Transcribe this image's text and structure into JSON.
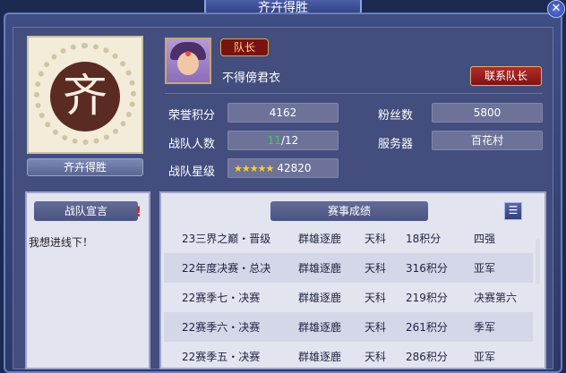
{
  "window": {
    "title": "齐卉得胜",
    "close_icon": "close-icon"
  },
  "team": {
    "emblem_char": "齐",
    "name": "齐卉得胜"
  },
  "captain": {
    "badge": "队长",
    "name": "不得傍君衣",
    "contact_button": "联系队长"
  },
  "stats": {
    "honor_label": "荣誉积分",
    "honor_value": "4162",
    "fans_label": "粉丝数",
    "fans_value": "5800",
    "members_label": "战队人数",
    "members_current": "11",
    "members_total": "/12",
    "server_label": "服务器",
    "server_value": "百花村",
    "rank_label": "战队星级",
    "rank_stars": "★★★★★",
    "rank_value": "42820"
  },
  "manifesto": {
    "title": "战队宣言",
    "alert": "!",
    "text": "我想进线下！"
  },
  "results": {
    "title": "赛事成绩",
    "rows": [
      {
        "event": "23三界之巅・晋级",
        "group": "群雄逐鹿",
        "division": "天科",
        "score": "18积分",
        "place": "四强"
      },
      {
        "event": "22年度决赛・总决",
        "group": "群雄逐鹿",
        "division": "天科",
        "score": "316积分",
        "place": "亚军"
      },
      {
        "event": "22赛季七・决赛",
        "group": "群雄逐鹿",
        "division": "天科",
        "score": "219积分",
        "place": "决赛第六"
      },
      {
        "event": "22赛季六・决赛",
        "group": "群雄逐鹿",
        "division": "天科",
        "score": "261积分",
        "place": "季军"
      },
      {
        "event": "22赛季五・决赛",
        "group": "群雄逐鹿",
        "division": "天科",
        "score": "286积分",
        "place": "亚军"
      }
    ]
  }
}
